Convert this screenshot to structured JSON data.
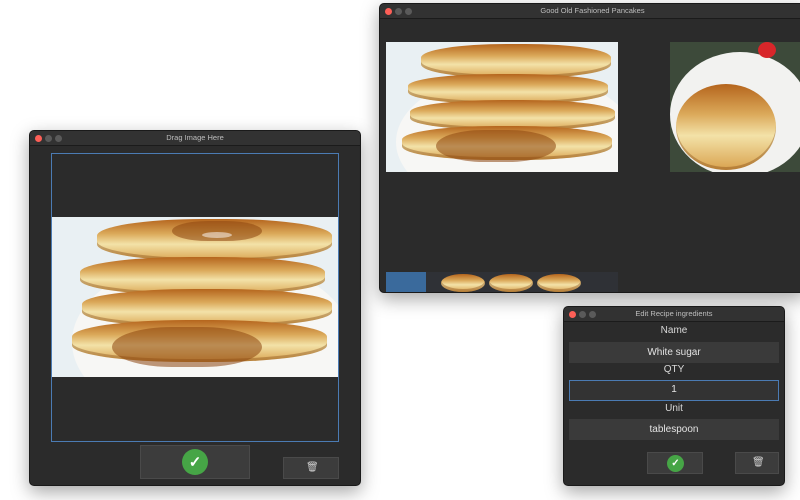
{
  "windows": {
    "drag": {
      "title": "Drag Image Here",
      "confirm_icon": "checkmark-icon",
      "delete_icon": "trash-icon"
    },
    "recipe": {
      "title": "Good Old Fashioned Pancakes",
      "thumbnails": [
        "pancake-stack-photo",
        "pancake-plate-photo",
        "pancakes-strip-photo"
      ]
    },
    "ingredients": {
      "title": "Edit Recipe ingredients",
      "name_label": "Name",
      "name_value": "White sugar",
      "qty_label": "QTY",
      "qty_value": "1",
      "unit_label": "Unit",
      "unit_value": "tablespoon",
      "confirm_icon": "checkmark-icon",
      "delete_icon": "trash-icon"
    }
  },
  "colors": {
    "window_bg": "#2b2b2b",
    "focus_border": "#4b7bb3",
    "confirm_green": "#46a546",
    "close_red": "#fe5f57"
  }
}
